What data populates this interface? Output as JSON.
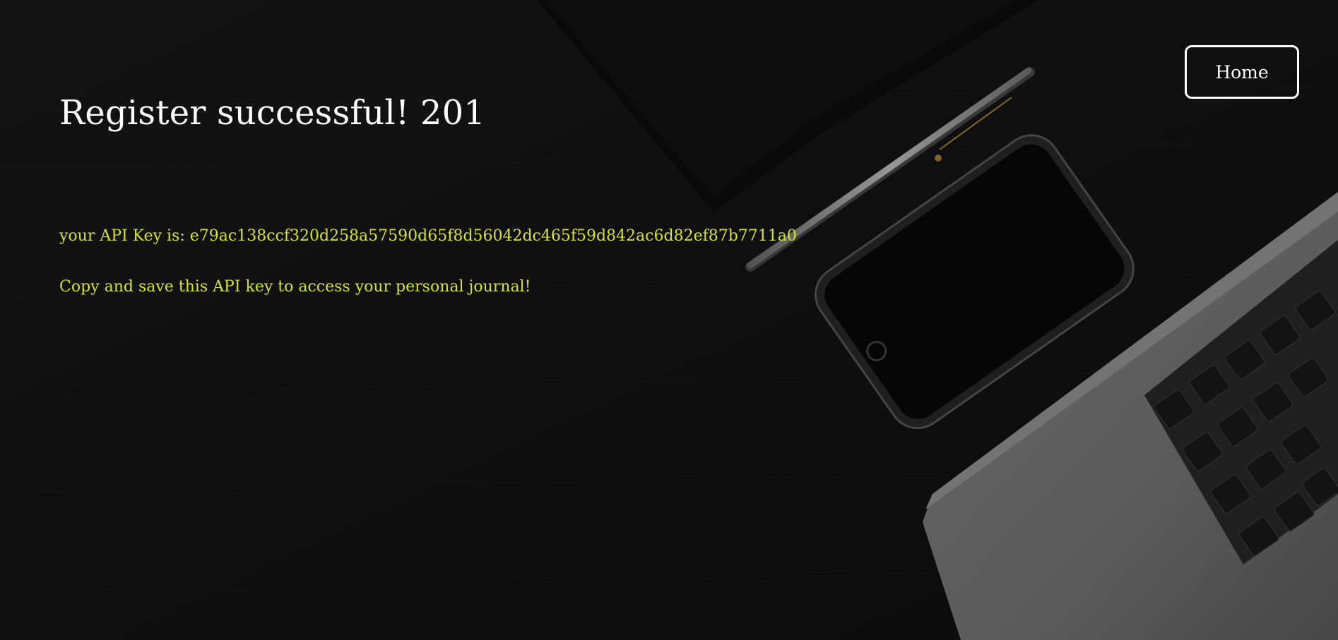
{
  "page": {
    "title": "Register successful! 201",
    "api_key_label": "your API Key is:",
    "api_key_value": "e79ac138ccf320d258a57590d65f8d56042dc465f59d842ac6d82ef87b7711a0",
    "instruction": "Copy and save this API key to access your personal journal!"
  },
  "nav": {
    "home_label": "Home"
  },
  "colors": {
    "background": "#151515",
    "title_text": "#ffffff",
    "accent_text": "#d7e22e",
    "button_border": "#ffffff"
  },
  "icons": {
    "background_image": "desk-with-notebook-pen-phone-laptop"
  }
}
